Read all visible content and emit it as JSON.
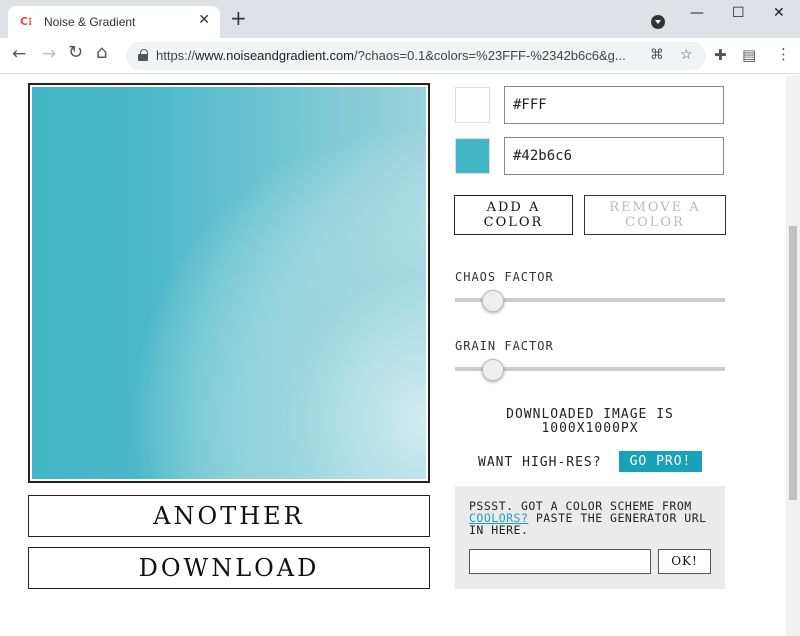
{
  "browser": {
    "tab_icon": "coolors-logo",
    "tab_title": "Noise & Gradient",
    "tab_close": "✕",
    "new_tab": "+",
    "url_prefix": "https://",
    "url_host": "www.noiseandgradient.com",
    "url_rest": "/?chaos=0.1&colors=%23FFF-%2342b6c6&g...",
    "window_minimize": "—",
    "window_maximize": "☐",
    "window_close": "✕"
  },
  "colors": [
    {
      "hex": "#FFF",
      "swatch": "#ffffff"
    },
    {
      "hex": "#42b6c6",
      "swatch": "#42b6c6"
    }
  ],
  "buttons": {
    "add_color": "ADD A COLOR",
    "remove_color": "REMOVE A COLOR",
    "another": "ANOTHER",
    "download": "DOWNLOAD",
    "go_pro": "GO PRO!",
    "ok": "OK!"
  },
  "sliders": {
    "chaos_label": "CHAOS FACTOR",
    "chaos_value": 0.1,
    "grain_label": "GRAIN FACTOR",
    "grain_value": 0.1
  },
  "info": {
    "downloaded_text": "DOWNLOADED IMAGE IS 1000X1000PX",
    "highres_text": "WANT HIGH-RES?"
  },
  "coolors": {
    "text_before": "PSSST. GOT A COLOR SCHEME FROM ",
    "link_text": "COOLORS?",
    "text_after": " PASTE THE GENERATOR URL IN HERE.",
    "input_value": ""
  },
  "theme": {
    "accent": "#17a2b8",
    "gradient_color": "#42b6c6"
  }
}
